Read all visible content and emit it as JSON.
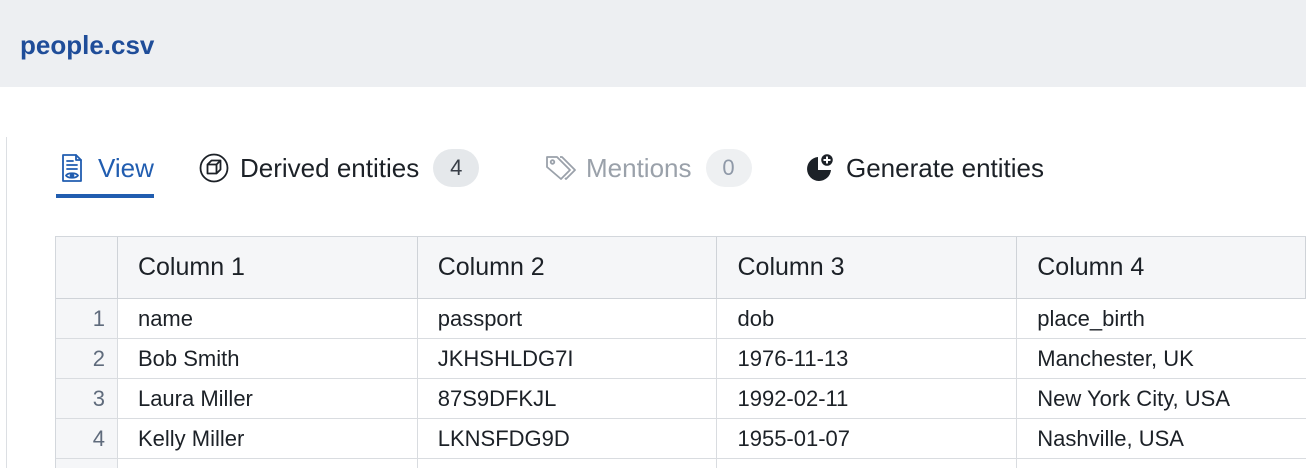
{
  "header": {
    "file_name": "people.csv"
  },
  "tabs": [
    {
      "label": "View",
      "icon": "document-eye-icon",
      "active": true
    },
    {
      "label": "Derived entities",
      "icon": "cube-icon",
      "count": "4"
    },
    {
      "label": "Mentions",
      "icon": "tags-icon",
      "count": "0",
      "disabled": true
    },
    {
      "label": "Generate entities",
      "icon": "pie-plus-icon"
    }
  ],
  "table": {
    "columns": [
      "Column 1",
      "Column 2",
      "Column 3",
      "Column 4"
    ],
    "rows": [
      {
        "index": "1",
        "cells": [
          "name",
          "passport",
          "dob",
          "place_birth"
        ]
      },
      {
        "index": "2",
        "cells": [
          "Bob Smith",
          "JKHSHLDG7I",
          "1976-11-13",
          "Manchester, UK"
        ]
      },
      {
        "index": "3",
        "cells": [
          "Laura Miller",
          "87S9DFKJL",
          "1992-02-11",
          "New York City, USA"
        ]
      },
      {
        "index": "4",
        "cells": [
          "Kelly Miller",
          "LKNSFDG9D",
          "1955-01-07",
          "Nashville, USA"
        ]
      }
    ]
  },
  "colors": {
    "accent": "#215db0",
    "header_bg": "#edeff2",
    "title": "#1f4d99"
  }
}
